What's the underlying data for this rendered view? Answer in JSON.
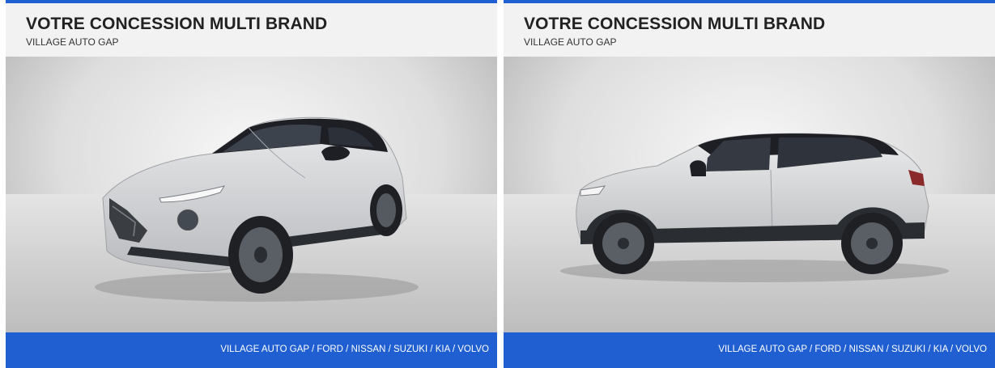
{
  "cards": [
    {
      "title": "VOTRE CONCESSION MULTI BRAND",
      "subtitle": "VILLAGE AUTO GAP",
      "photo": "car-front-three-quarter-view",
      "footer": "VILLAGE AUTO GAP / FORD / NISSAN / SUZUKI / KIA / VOLVO"
    },
    {
      "title": "VOTRE CONCESSION MULTI BRAND",
      "subtitle": "VILLAGE AUTO GAP",
      "photo": "car-side-view",
      "footer": "VILLAGE AUTO GAP / FORD / NISSAN / SUZUKI / KIA / VOLVO"
    }
  ],
  "colors": {
    "accent": "#1f5fd1",
    "header_bg": "#f2f2f2",
    "car_body": "#d3d4d6",
    "car_roof": "#1d1f24"
  }
}
